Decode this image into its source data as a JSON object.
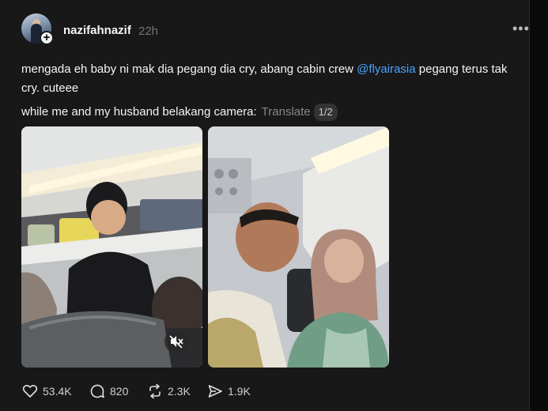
{
  "post": {
    "username": "nazifahnazif",
    "time": "22h",
    "text_before_mention": "mengada eh baby ni mak dia pegang dia cry, abang cabin crew ",
    "mention": "@flyairasia",
    "text_after_mention": " pegang terus tak cry. cuteee",
    "text2": "while me and my husband belakang camera:",
    "translate": "Translate",
    "page_indicator": "1/2",
    "more_label": "•••"
  },
  "actions": {
    "likes": "53.4K",
    "replies": "820",
    "reposts": "2.3K",
    "shares": "1.9K"
  },
  "colors": {
    "background": "#181818",
    "mention": "#4aa3ff",
    "muted": "#777777"
  },
  "icons": [
    "plus-icon",
    "more-icon",
    "mute-icon",
    "heart-icon",
    "comment-icon",
    "repost-icon",
    "share-icon"
  ]
}
